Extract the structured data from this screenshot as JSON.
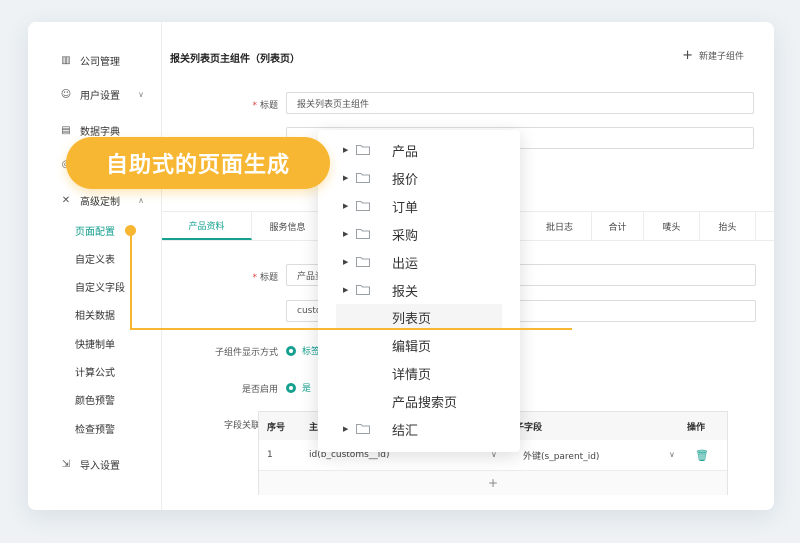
{
  "sidebar": {
    "items": [
      {
        "label": "公司管理",
        "icon": "building-icon"
      },
      {
        "label": "用户设置",
        "icon": "user-icon"
      },
      {
        "label": "数据字典",
        "icon": "book-icon"
      },
      {
        "label": "",
        "icon": "target-icon"
      },
      {
        "label": "高级定制",
        "icon": "tools-icon"
      },
      {
        "label": "导入设置",
        "icon": "import-icon"
      }
    ],
    "subitems": [
      "页面配置",
      "自定义表",
      "自定义字段",
      "相关数据",
      "快捷制单",
      "计算公式",
      "颜色预警",
      "检查预警"
    ]
  },
  "header": {
    "title": "报关列表页主组件（列表页）",
    "new_child": "新建子组件"
  },
  "form1": {
    "title_label": "标题",
    "title_value": "报关列表页主组件"
  },
  "tabs": [
    "产品资料",
    "服务信息",
    "",
    "",
    "",
    "",
    "批日志",
    "合计",
    "唛头",
    "抬头"
  ],
  "form2": {
    "title_label": "标题",
    "title_value": "产品资料",
    "code_value": "custom pro",
    "display_label": "子组件显示方式",
    "display_value": "标签页",
    "enabled_label": "是否启用",
    "enabled_yes": "是",
    "relation_label": "字段关联关系"
  },
  "table": {
    "headers": {
      "seq": "序号",
      "main": "主",
      "child": "子字段",
      "ops": "操作"
    },
    "rows": [
      {
        "seq": "1",
        "main": "id(b_customs__id)",
        "child": "外键(s_parent_id)"
      }
    ],
    "add": "+"
  },
  "tree": [
    {
      "label": "产品",
      "folder": true
    },
    {
      "label": "报价",
      "folder": true
    },
    {
      "label": "订单",
      "folder": true
    },
    {
      "label": "采购",
      "folder": true
    },
    {
      "label": "出运",
      "folder": true
    },
    {
      "label": "报关",
      "folder": true,
      "open": true
    },
    {
      "label": "列表页",
      "folder": false
    },
    {
      "label": "编辑页",
      "folder": false
    },
    {
      "label": "详情页",
      "folder": false
    },
    {
      "label": "产品搜索页",
      "folder": false
    },
    {
      "label": "结汇",
      "folder": true
    }
  ],
  "banner": {
    "text": "自助式的页面生成"
  },
  "colors": {
    "accent": "#16a090",
    "banner": "#f7b733"
  }
}
